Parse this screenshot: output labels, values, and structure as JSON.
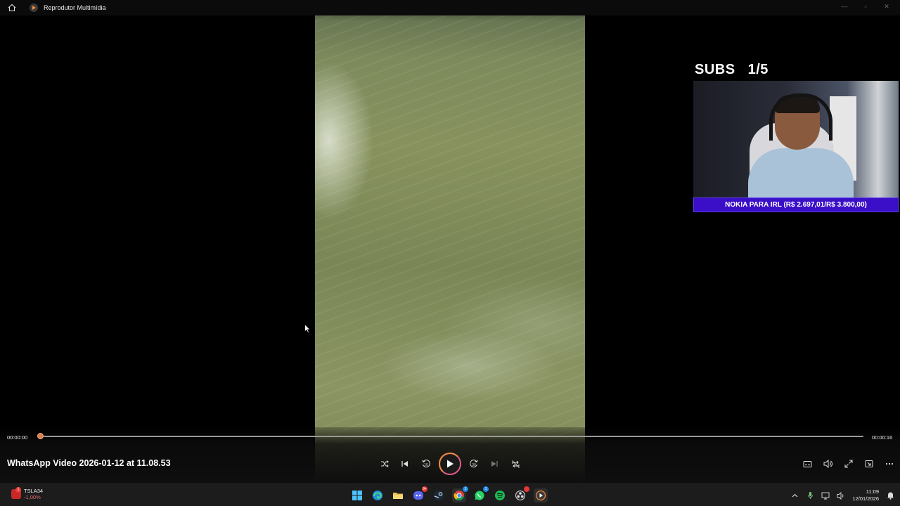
{
  "titlebar": {
    "app_title": "Reprodutor Multimídia",
    "icons": [
      "home-icon",
      "media-player-icon"
    ],
    "window_controls": [
      "minimize-icon",
      "restore-icon",
      "close-icon"
    ]
  },
  "overlay": {
    "subs_label": "SUBS",
    "subs_count": "1/5",
    "banner_text": "NOKIA PARA IRL (R$ 2.697,01/R$ 3.800,00)"
  },
  "player": {
    "current_time": "00:00:00",
    "total_time": "00:00:16",
    "progress_fraction": 0,
    "video_title": "WhatsApp Video 2026-01-12 at 11.08.53",
    "controls": [
      "shuffle-icon",
      "previous-icon",
      "rewind-10-icon",
      "play-icon",
      "forward-30-icon",
      "next-icon",
      "repeat-off-icon"
    ],
    "right_controls": [
      "captions-icon",
      "volume-icon",
      "fullscreen-icon",
      "miniplayer-icon",
      "more-icon"
    ],
    "rewind_label": "10",
    "forward_label": "30"
  },
  "taskbar": {
    "stock_name": "TSLA34",
    "stock_change": "-1,00%",
    "stock_badge": "1",
    "apps": [
      "windows-start-icon",
      "edge-icon",
      "file-explorer-icon",
      "discord-icon",
      "steam-icon",
      "chrome-icon",
      "whatsapp-icon",
      "spotify-icon",
      "obs-icon",
      "media-player-icon"
    ],
    "badges": {
      "discord": "9+",
      "chrome": "3",
      "whatsapp": "1"
    },
    "time": "11:09",
    "date": "12/01/2026"
  },
  "colors": {
    "accent_orange": "#e07b4a",
    "accent_pink": "#e25a8a",
    "banner_purple": "#3b0fc7",
    "background": "#000000"
  }
}
